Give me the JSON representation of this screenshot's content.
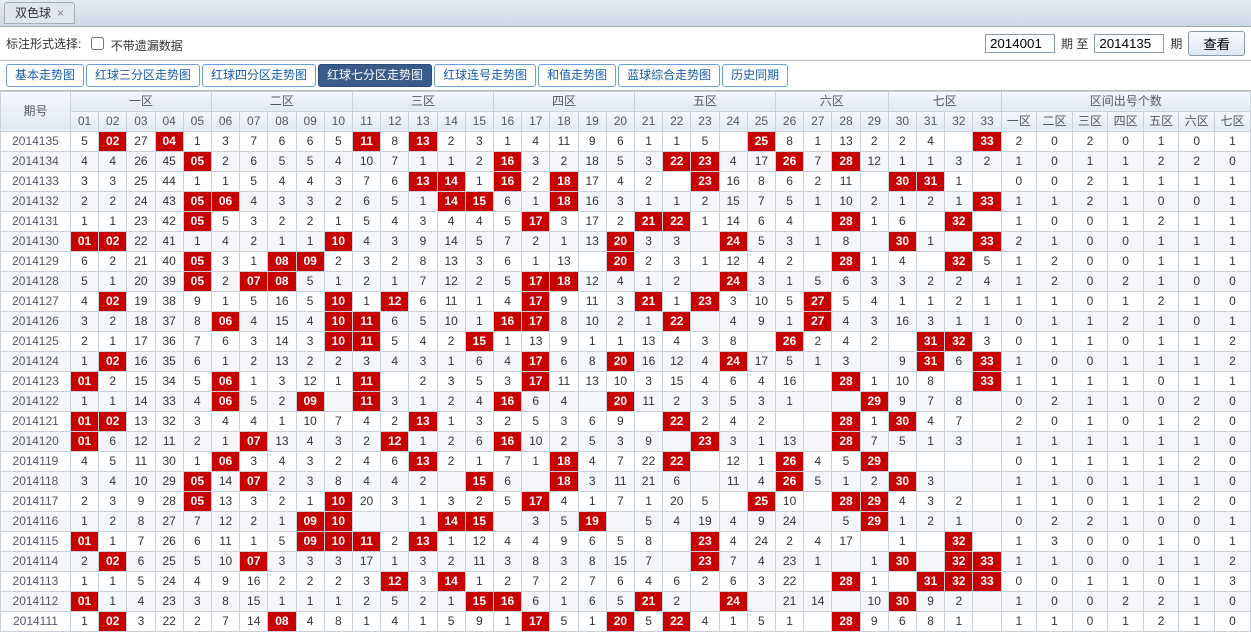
{
  "app_tab": {
    "name": "双色球"
  },
  "config": {
    "label": "标注形式选择:",
    "chk": "不带遗漏数据",
    "from": "2014001",
    "mid": "期 至",
    "to": "2014135",
    "unit": "期",
    "view": "查看"
  },
  "subtabs": [
    "基本走势图",
    "红球三分区走势图",
    "红球四分区走势图",
    "红球七分区走势图",
    "红球连号走势图",
    "和值走势图",
    "蓝球综合走势图",
    "历史同期"
  ],
  "subtabs_active": 3,
  "header": {
    "period": "期号",
    "zones": [
      "一区",
      "二区",
      "三区",
      "四区",
      "五区",
      "六区",
      "七区"
    ],
    "count_title": "区间出号个数"
  },
  "cols": [
    "01",
    "02",
    "03",
    "04",
    "05",
    "06",
    "07",
    "08",
    "09",
    "10",
    "11",
    "12",
    "13",
    "14",
    "15",
    "16",
    "17",
    "18",
    "19",
    "20",
    "21",
    "22",
    "23",
    "24",
    "25",
    "26",
    "27",
    "28",
    "29",
    "30",
    "31",
    "32",
    "33"
  ],
  "rows": [
    {
      "p": "2014135",
      "v": [
        5,
        "",
        27,
        "",
        1,
        3,
        7,
        6,
        6,
        5,
        "",
        8,
        "",
        2,
        3,
        1,
        4,
        11,
        9,
        6,
        1,
        1,
        5,
        "",
        1,
        8,
        1,
        13,
        2,
        2,
        4,
        "",
        ""
      ],
      "hit": [
        2,
        4,
        11,
        13,
        25,
        33
      ],
      "cnt": [
        2,
        0,
        2,
        0,
        1,
        0,
        1
      ]
    },
    {
      "p": "2014134",
      "v": [
        4,
        4,
        26,
        45,
        "",
        2,
        6,
        5,
        5,
        4,
        10,
        7,
        1,
        1,
        2,
        "",
        3,
        2,
        18,
        5,
        3,
        "",
        "",
        4,
        17,
        "",
        7,
        "",
        12,
        1,
        1,
        3,
        2
      ],
      "hit": [
        5,
        16,
        22,
        23,
        26,
        28
      ],
      "cnt": [
        1,
        0,
        1,
        1,
        2,
        2,
        0
      ]
    },
    {
      "p": "2014133",
      "v": [
        3,
        3,
        25,
        44,
        1,
        1,
        5,
        4,
        4,
        3,
        7,
        6,
        "",
        "",
        1,
        "",
        2,
        "",
        17,
        4,
        2,
        "",
        3,
        16,
        8,
        6,
        2,
        11,
        "",
        "",
        2,
        1,
        ""
      ],
      "hit": [
        13,
        14,
        16,
        18,
        23,
        30,
        31
      ],
      "cnt": [
        0,
        0,
        2,
        1,
        1,
        1,
        1
      ]
    },
    {
      "p": "2014132",
      "v": [
        2,
        2,
        24,
        43,
        "",
        "",
        4,
        3,
        3,
        2,
        6,
        5,
        1,
        "",
        "",
        6,
        1,
        "",
        16,
        3,
        1,
        1,
        2,
        15,
        7,
        5,
        1,
        10,
        2,
        1,
        2,
        1,
        ""
      ],
      "hit": [
        5,
        6,
        14,
        15,
        18,
        33
      ],
      "cnt": [
        1,
        1,
        2,
        1,
        0,
        0,
        1
      ]
    },
    {
      "p": "2014131",
      "v": [
        1,
        1,
        23,
        42,
        "",
        5,
        3,
        2,
        2,
        1,
        5,
        4,
        3,
        4,
        4,
        5,
        "",
        3,
        17,
        2,
        "",
        "",
        1,
        14,
        6,
        4,
        "",
        9,
        1,
        6,
        "",
        1,
        ""
      ],
      "hit": [
        5,
        17,
        21,
        22,
        28,
        32
      ],
      "cnt": [
        1,
        0,
        0,
        1,
        2,
        1,
        1
      ]
    },
    {
      "p": "2014130",
      "v": [
        "",
        "",
        22,
        41,
        1,
        4,
        2,
        1,
        1,
        "",
        4,
        3,
        9,
        14,
        5,
        7,
        2,
        1,
        13,
        "",
        3,
        3,
        "",
        13,
        5,
        3,
        1,
        8,
        "",
        5,
        1,
        "",
        ""
      ],
      "hit": [
        1,
        2,
        10,
        20,
        24,
        30,
        33
      ],
      "cnt": [
        2,
        1,
        0,
        0,
        1,
        1,
        1
      ]
    },
    {
      "p": "2014129",
      "v": [
        6,
        2,
        21,
        40,
        "",
        3,
        1,
        "",
        "",
        2,
        3,
        2,
        8,
        13,
        3,
        6,
        1,
        13,
        "",
        2,
        2,
        3,
        1,
        12,
        4,
        2,
        "",
        7,
        1,
        4,
        "",
        1,
        5
      ],
      "hit": [
        5,
        8,
        9,
        20,
        28,
        32
      ],
      "cnt": [
        1,
        2,
        0,
        0,
        1,
        1,
        1
      ]
    },
    {
      "p": "2014128",
      "v": [
        5,
        1,
        20,
        39,
        "",
        2,
        "",
        "",
        5,
        1,
        2,
        1,
        7,
        12,
        2,
        5,
        "",
        "",
        12,
        4,
        1,
        2,
        "",
        11,
        3,
        1,
        5,
        6,
        3,
        3,
        2,
        2,
        4
      ],
      "hit": [
        5,
        7,
        8,
        17,
        18,
        24
      ],
      "cnt": [
        1,
        2,
        0,
        2,
        1,
        0,
        0
      ]
    },
    {
      "p": "2014127",
      "v": [
        4,
        "",
        19,
        38,
        9,
        1,
        5,
        16,
        5,
        "",
        1,
        "",
        6,
        11,
        1,
        4,
        "",
        9,
        11,
        3,
        "",
        1,
        "",
        3,
        10,
        5,
        "",
        5,
        4,
        1,
        1,
        2,
        1
      ],
      "hit": [
        2,
        10,
        12,
        17,
        21,
        23,
        27
      ],
      "cnt": [
        1,
        1,
        0,
        1,
        2,
        1,
        0
      ]
    },
    {
      "p": "2014126",
      "v": [
        3,
        2,
        18,
        37,
        8,
        "",
        4,
        15,
        4,
        "",
        "",
        6,
        5,
        10,
        1,
        "",
        "",
        8,
        10,
        2,
        1,
        14,
        "",
        4,
        9,
        1,
        "",
        4,
        3,
        16,
        3,
        1,
        1
      ],
      "hit": [
        6,
        10,
        11,
        16,
        17,
        22,
        27
      ],
      "cnt": [
        0,
        1,
        1,
        2,
        1,
        0,
        1
      ]
    },
    {
      "p": "2014125",
      "v": [
        2,
        1,
        17,
        36,
        7,
        6,
        3,
        14,
        3,
        "",
        "",
        5,
        4,
        2,
        "",
        1,
        13,
        9,
        1,
        1,
        13,
        4,
        3,
        8,
        "",
        18,
        2,
        4,
        2,
        "",
        "",
        7,
        3
      ],
      "hit": [
        10,
        11,
        15,
        26,
        31,
        32
      ],
      "cnt": [
        0,
        1,
        1,
        0,
        1,
        1,
        2
      ]
    },
    {
      "p": "2014124",
      "v": [
        1,
        "",
        16,
        35,
        6,
        1,
        2,
        13,
        2,
        2,
        3,
        4,
        3,
        1,
        6,
        4,
        "",
        6,
        8,
        "",
        16,
        12,
        4,
        "",
        17,
        5,
        1,
        3,
        "",
        9,
        "",
        6,
        ""
      ],
      "hit": [
        2,
        17,
        20,
        24,
        31,
        33
      ],
      "cnt": [
        1,
        0,
        0,
        1,
        1,
        1,
        2
      ]
    },
    {
      "p": "2014123",
      "v": [
        "",
        2,
        15,
        34,
        5,
        "",
        1,
        3,
        12,
        1,
        6,
        "",
        2,
        3,
        5,
        3,
        "",
        11,
        13,
        10,
        3,
        15,
        4,
        6,
        4,
        16,
        "",
        2,
        1,
        10,
        8,
        "",
        ""
      ],
      "hit": [
        1,
        6,
        11,
        17,
        28,
        33
      ],
      "cnt": [
        1,
        1,
        1,
        1,
        0,
        1,
        1
      ]
    },
    {
      "p": "2014122",
      "v": [
        1,
        1,
        14,
        33,
        4,
        "",
        5,
        2,
        11,
        "",
        "",
        3,
        1,
        2,
        4,
        "",
        6,
        4,
        "",
        10,
        11,
        2,
        3,
        5,
        3,
        1,
        "",
        "",
        2,
        9,
        7,
        8,
        ""
      ],
      "hit": [
        6,
        9,
        11,
        16,
        20,
        29
      ],
      "cnt": [
        0,
        2,
        1,
        1,
        0,
        2,
        0
      ]
    },
    {
      "p": "2014121",
      "v": [
        "",
        "",
        13,
        32,
        3,
        4,
        4,
        1,
        10,
        7,
        4,
        2,
        "",
        1,
        3,
        2,
        5,
        3,
        6,
        9,
        "",
        1,
        2,
        4,
        2,
        "",
        "",
        1,
        1,
        6,
        4,
        7,
        ""
      ],
      "hit": [
        1,
        2,
        13,
        22,
        28,
        30
      ],
      "cnt": [
        2,
        0,
        1,
        0,
        1,
        2,
        0
      ]
    },
    {
      "p": "2014120",
      "v": [
        "",
        6,
        12,
        11,
        2,
        1,
        "",
        13,
        4,
        3,
        2,
        "",
        1,
        2,
        6,
        "",
        10,
        2,
        5,
        3,
        9,
        "",
        1,
        3,
        1,
        13,
        "",
        2,
        7,
        5,
        1,
        3,
        ""
      ],
      "hit": [
        1,
        7,
        12,
        16,
        23,
        28
      ],
      "cnt": [
        1,
        1,
        1,
        1,
        1,
        1,
        0
      ]
    },
    {
      "p": "2014119",
      "v": [
        4,
        5,
        11,
        30,
        1,
        "",
        3,
        4,
        3,
        2,
        4,
        6,
        "",
        2,
        1,
        7,
        1,
        "",
        4,
        7,
        22,
        "",
        "",
        12,
        1,
        16,
        4,
        5,
        2,
        "",
        ""
      ],
      "hit": [
        6,
        13,
        18,
        22,
        26,
        29
      ],
      "cnt": [
        0,
        1,
        1,
        1,
        1,
        2,
        0
      ]
    },
    {
      "p": "2014118",
      "v": [
        3,
        4,
        10,
        29,
        "",
        14,
        "",
        2,
        3,
        8,
        4,
        4,
        2,
        "",
        2,
        6,
        "",
        "",
        3,
        11,
        21,
        6,
        "",
        11,
        4,
        14,
        5,
        1,
        2,
        3,
        3,
        ""
      ],
      "hit": [
        5,
        7,
        15,
        18,
        26,
        30
      ],
      "cnt": [
        1,
        1,
        0,
        1,
        1,
        1,
        0
      ]
    },
    {
      "p": "2014117",
      "v": [
        2,
        3,
        9,
        28,
        "",
        13,
        3,
        2,
        1,
        "",
        20,
        3,
        1,
        3,
        2,
        5,
        "",
        4,
        1,
        7,
        1,
        20,
        5,
        "",
        25,
        10,
        "",
        "",
        1,
        4,
        3,
        2,
        ""
      ],
      "hit": [
        5,
        10,
        17,
        25,
        28,
        29
      ],
      "cnt": [
        1,
        1,
        0,
        1,
        1,
        2,
        0
      ]
    },
    {
      "p": "2014116",
      "v": [
        1,
        2,
        8,
        27,
        7,
        12,
        2,
        1,
        5,
        "",
        "",
        "",
        1,
        1,
        "",
        "",
        3,
        5,
        10,
        "",
        5,
        4,
        19,
        4,
        9,
        24,
        "",
        5,
        23,
        1,
        2,
        1,
        ""
      ],
      "hit": [
        9,
        10,
        14,
        15,
        19,
        29
      ],
      "cnt": [
        0,
        2,
        2,
        1,
        0,
        0,
        1
      ]
    },
    {
      "p": "2014115",
      "v": [
        "",
        1,
        7,
        26,
        6,
        11,
        1,
        5,
        "",
        "",
        "",
        2,
        "",
        1,
        12,
        4,
        4,
        9,
        6,
        5,
        8,
        "",
        1,
        4,
        24,
        2,
        4,
        17,
        "",
        1,
        ""
      ],
      "hit": [
        1,
        9,
        10,
        11,
        13,
        23,
        32
      ],
      "cnt": [
        1,
        3,
        0,
        0,
        1,
        0,
        1
      ]
    },
    {
      "p": "2014114",
      "v": [
        2,
        "",
        6,
        25,
        5,
        10,
        "",
        3,
        3,
        3,
        17,
        1,
        3,
        2,
        11,
        3,
        8,
        3,
        8,
        15,
        7,
        "",
        3,
        7,
        4,
        23,
        1,
        "",
        1,
        16,
        "",
        "",
        ""
      ],
      "hit": [
        2,
        7,
        23,
        30,
        32,
        33
      ],
      "cnt": [
        1,
        1,
        0,
        0,
        1,
        1,
        2
      ]
    },
    {
      "p": "2014113",
      "v": [
        1,
        1,
        5,
        24,
        4,
        9,
        16,
        2,
        2,
        2,
        3,
        "",
        3,
        "",
        1,
        2,
        7,
        2,
        7,
        6,
        4,
        6,
        2,
        6,
        3,
        22,
        "",
        15,
        1,
        "",
        "",
        "",
        ""
      ],
      "hit": [
        12,
        14,
        28,
        31,
        32,
        33
      ],
      "cnt": [
        0,
        0,
        1,
        1,
        0,
        1,
        3
      ]
    },
    {
      "p": "2014112",
      "v": [
        "",
        1,
        4,
        23,
        3,
        8,
        15,
        1,
        1,
        1,
        2,
        5,
        2,
        1,
        "",
        "",
        6,
        1,
        6,
        5,
        "",
        2,
        "",
        14,
        "",
        21,
        14,
        "",
        10,
        7,
        9,
        2,
        ""
      ],
      "hit": [
        1,
        15,
        16,
        21,
        24,
        30
      ],
      "cnt": [
        1,
        0,
        0,
        2,
        2,
        1,
        0
      ]
    },
    {
      "p": "2014111",
      "v": [
        1,
        "",
        3,
        22,
        2,
        7,
        14,
        "",
        4,
        8,
        1,
        4,
        1,
        5,
        9,
        1,
        "",
        5,
        1,
        "",
        5,
        "",
        4,
        1,
        5,
        1,
        "",
        13,
        9,
        6,
        8,
        1,
        ""
      ],
      "hit": [
        2,
        8,
        17,
        20,
        22,
        28
      ],
      "cnt": [
        1,
        1,
        0,
        1,
        2,
        1,
        0
      ]
    }
  ]
}
